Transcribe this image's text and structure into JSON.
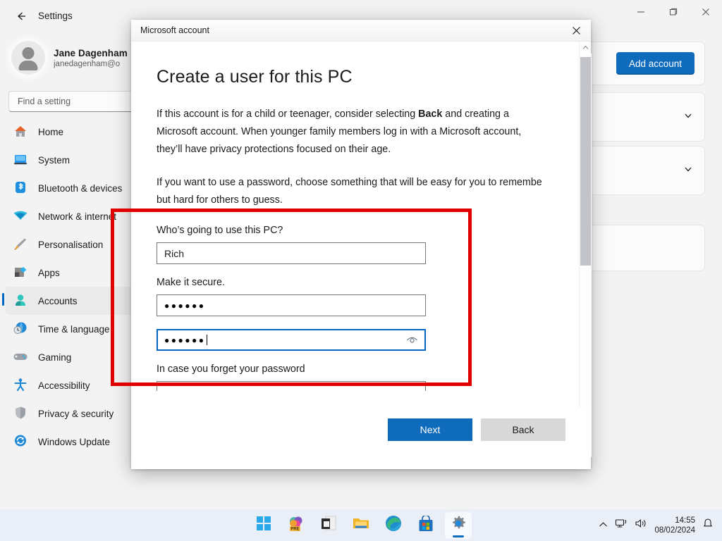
{
  "settings_window": {
    "title": "Settings",
    "back_icon": "back-arrow-icon",
    "controls": {
      "minimize": "minimize-icon",
      "maximize": "maximize-icon",
      "close": "close-icon"
    },
    "profile": {
      "name": "Jane Dagenham",
      "email": "janedagenham@o",
      "avatar_icon": "person-avatar-icon"
    },
    "search": {
      "placeholder": "Find a setting",
      "value": ""
    },
    "nav_items": [
      {
        "label": "Home",
        "icon": "home-icon",
        "selected": false
      },
      {
        "label": "System",
        "icon": "system-icon",
        "selected": false
      },
      {
        "label": "Bluetooth & devices",
        "icon": "bluetooth-icon",
        "selected": false
      },
      {
        "label": "Network & internet",
        "icon": "network-icon",
        "selected": false
      },
      {
        "label": "Personalisation",
        "icon": "paintbrush-icon",
        "selected": false
      },
      {
        "label": "Apps",
        "icon": "apps-icon",
        "selected": false
      },
      {
        "label": "Accounts",
        "icon": "accounts-icon",
        "selected": true
      },
      {
        "label": "Time & language",
        "icon": "clock-globe-icon",
        "selected": false
      },
      {
        "label": "Gaming",
        "icon": "gamepad-icon",
        "selected": false
      },
      {
        "label": "Accessibility",
        "icon": "accessibility-icon",
        "selected": false
      },
      {
        "label": "Privacy & security",
        "icon": "shield-icon",
        "selected": false
      },
      {
        "label": "Windows Update",
        "icon": "update-icon",
        "selected": false
      }
    ],
    "content": {
      "add_account_button": "Add account",
      "expand_icon": "chevron-down-icon"
    }
  },
  "dialog": {
    "title": "Microsoft account",
    "close_icon": "close-icon",
    "heading": "Create a user for this PC",
    "paragraph1_part1": "If this account is for a child or teenager, consider selecting ",
    "paragraph1_bold": "Back",
    "paragraph1_part2": " and creating a",
    "paragraph1_line2": "Microsoft account. When younger family members log in with a Microsoft account,",
    "paragraph1_line3": "they’ll have privacy protections focused on their age.",
    "paragraph2_line1": "If you want to use a password, choose something that will be easy for you to remembe",
    "paragraph2_line2": "but hard for others to guess.",
    "username_label": "Who’s going to use this PC?",
    "username_value": "Rich",
    "password_label": "Make it secure.",
    "password_value": "●●●●●●",
    "confirm_password_value": "●●●●●●",
    "reveal_password_icon": "eye-reveal-icon",
    "hint_label": "In case you forget your password",
    "hint_value": "",
    "next_button": "Next",
    "back_button": "Back",
    "scrollbar": {
      "up_icon": "chevron-up-icon",
      "down_icon": "chevron-down-icon"
    }
  },
  "taskbar": {
    "items": [
      {
        "icon": "windows-start-icon",
        "active": false
      },
      {
        "icon": "copilot-pre-icon",
        "active": false
      },
      {
        "icon": "widgets-icon",
        "active": false
      },
      {
        "icon": "file-explorer-icon",
        "active": false
      },
      {
        "icon": "microsoft-edge-icon",
        "active": false
      },
      {
        "icon": "microsoft-store-icon",
        "active": false
      },
      {
        "icon": "settings-gear-icon",
        "active": true
      }
    ],
    "tray": {
      "overflow_icon": "chevron-up-icon",
      "network_icon": "network-tray-icon",
      "volume_icon": "volume-icon",
      "time": "14:55",
      "date": "08/02/2024",
      "notification_icon": "bell-icon"
    }
  },
  "annotation": {
    "color": "#e00000",
    "shape": "rectangle"
  }
}
